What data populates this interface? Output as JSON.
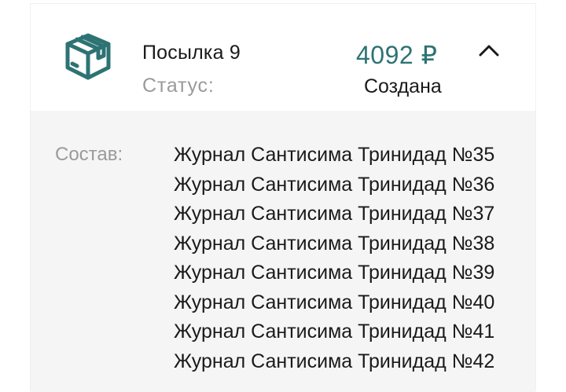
{
  "parcel": {
    "title": "Посылка 9",
    "status_label": "Статус:",
    "status_value": "Создана",
    "price": "4092 ₽",
    "composition_label": "Состав:",
    "items": [
      "Журнал Сантисима Тринидад №35",
      "Журнал Сантисима Тринидад №36",
      "Журнал Сантисима Тринидад №37",
      "Журнал Сантисима Тринидад №38",
      "Журнал Сантисима Тринидад №39",
      "Журнал Сантисима Тринидад №40",
      "Журнал Сантисима Тринидад №41",
      "Журнал Сантисима Тринидад №42"
    ]
  },
  "icons": {
    "package": "package-box-icon",
    "collapse": "chevron-up-icon"
  },
  "colors": {
    "accent": "#2e7373",
    "muted_text": "#9a9a9a",
    "panel_background": "#f5f5f5"
  }
}
